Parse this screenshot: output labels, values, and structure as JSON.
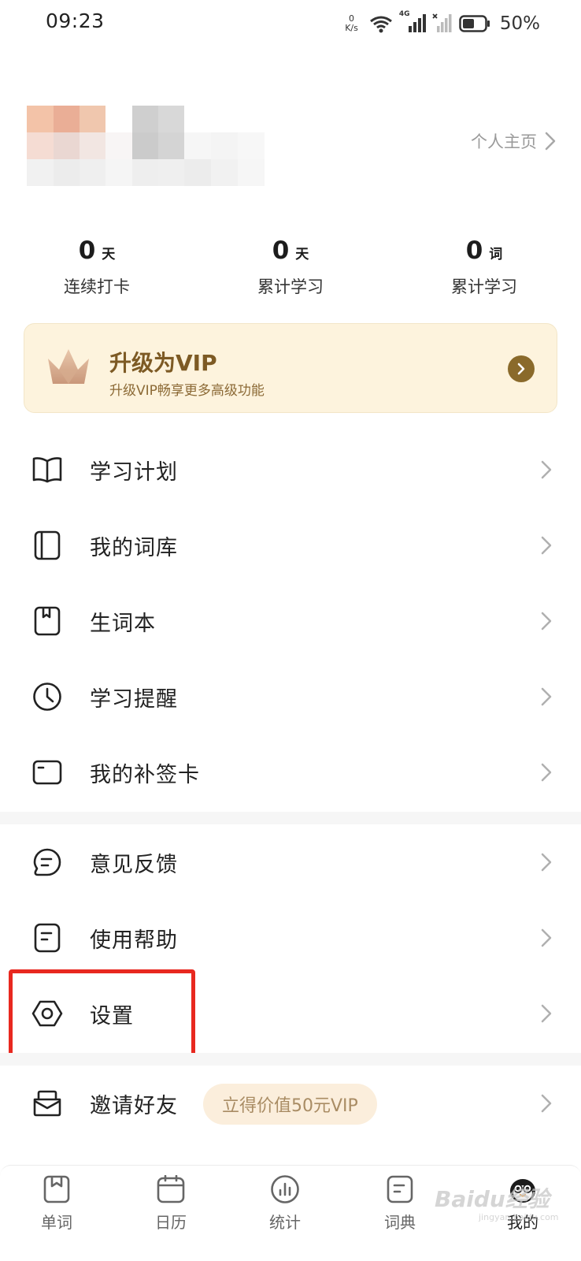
{
  "status_bar": {
    "time": "09:23",
    "net_speed_value": "0",
    "net_speed_unit": "K/s",
    "network_label": "4G",
    "battery_percent": "50%"
  },
  "profile": {
    "homepage_link": "个人主页"
  },
  "stats": [
    {
      "value": "0",
      "unit": "天",
      "label": "连续打卡"
    },
    {
      "value": "0",
      "unit": "天",
      "label": "累计学习"
    },
    {
      "value": "0",
      "unit": "词",
      "label": "累计学习"
    }
  ],
  "vip": {
    "title": "升级为VIP",
    "subtitle": "升级VIP畅享更多高级功能"
  },
  "menu_group_1": [
    {
      "label": "学习计划",
      "icon": "open-book-icon"
    },
    {
      "label": "我的词库",
      "icon": "wordbook-icon"
    },
    {
      "label": "生词本",
      "icon": "bookmark-notebook-icon"
    },
    {
      "label": "学习提醒",
      "icon": "clock-icon"
    },
    {
      "label": "我的补签卡",
      "icon": "card-icon"
    }
  ],
  "menu_group_2": [
    {
      "label": "意见反馈",
      "icon": "chat-bubble-icon"
    },
    {
      "label": "使用帮助",
      "icon": "document-icon"
    },
    {
      "label": "设置",
      "icon": "hexagon-gear-icon"
    }
  ],
  "invite": {
    "label": "邀请好友",
    "badge": "立得价值50元VIP"
  },
  "tabs": [
    {
      "label": "单词",
      "icon": "word-icon"
    },
    {
      "label": "日历",
      "icon": "calendar-icon"
    },
    {
      "label": "统计",
      "icon": "chart-icon"
    },
    {
      "label": "词典",
      "icon": "dictionary-icon"
    },
    {
      "label": "我的",
      "icon": "mascot-avatar-icon",
      "active": true
    }
  ],
  "watermark": {
    "text": "Baidu经验",
    "sub": "jingyan.baidu.com"
  },
  "colors": {
    "vip_background": "#fdf3dd",
    "vip_text": "#7d5a24",
    "highlight_red": "#e8281f"
  }
}
